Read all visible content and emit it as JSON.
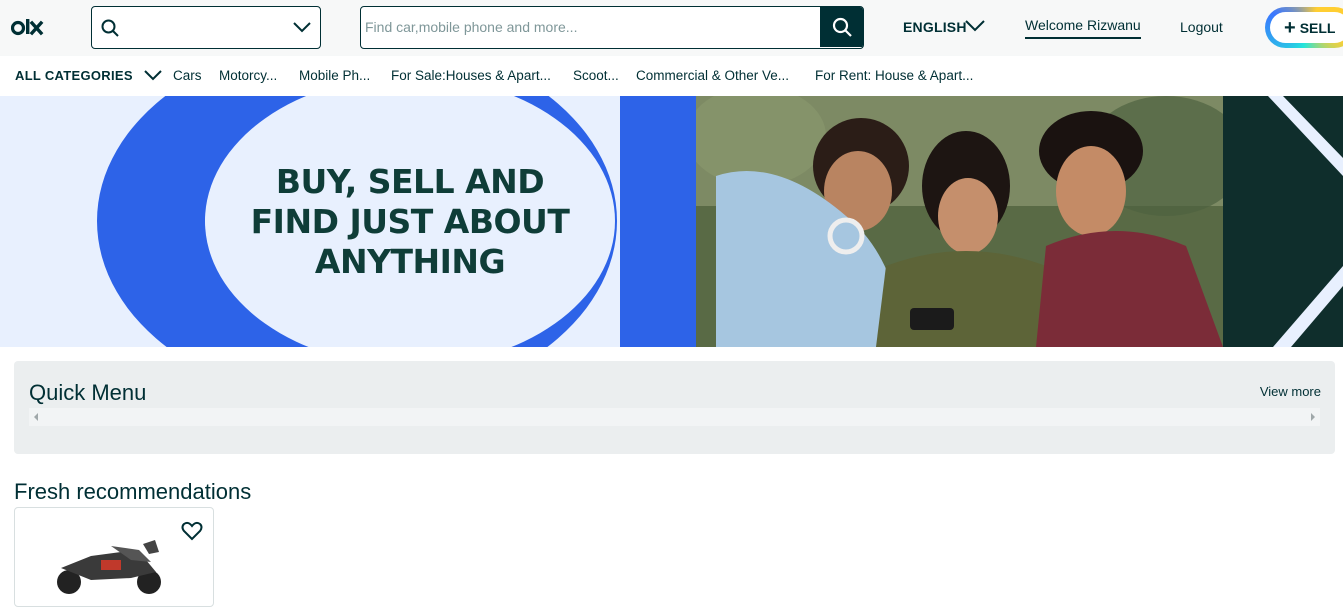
{
  "header": {
    "location_value": "",
    "search_placeholder": "Find car,mobile phone and more...",
    "search_value": "",
    "language": "ENGLISH",
    "welcome": "Welcome Rizwanu",
    "logout": "Logout",
    "sell": "SELL"
  },
  "categories": {
    "all_label": "ALL CATEGORIES",
    "items": [
      "Cars",
      "Motorcy...",
      "Mobile Ph...",
      "For Sale:Houses & Apart...",
      "Scoot...",
      "Commercial & Other Ve...",
      "For Rent: House & Apart..."
    ]
  },
  "banner": {
    "line1": "BUY, SELL AND",
    "line2": "FIND JUST ABOUT",
    "line3": "ANYTHING"
  },
  "quick_menu": {
    "title": "Quick Menu",
    "view_more": "View more"
  },
  "fresh": {
    "title": "Fresh recommendations"
  },
  "colors": {
    "primary": "#002f34",
    "banner_blue": "#2d63e8",
    "banner_bg": "#e8f0fe"
  }
}
